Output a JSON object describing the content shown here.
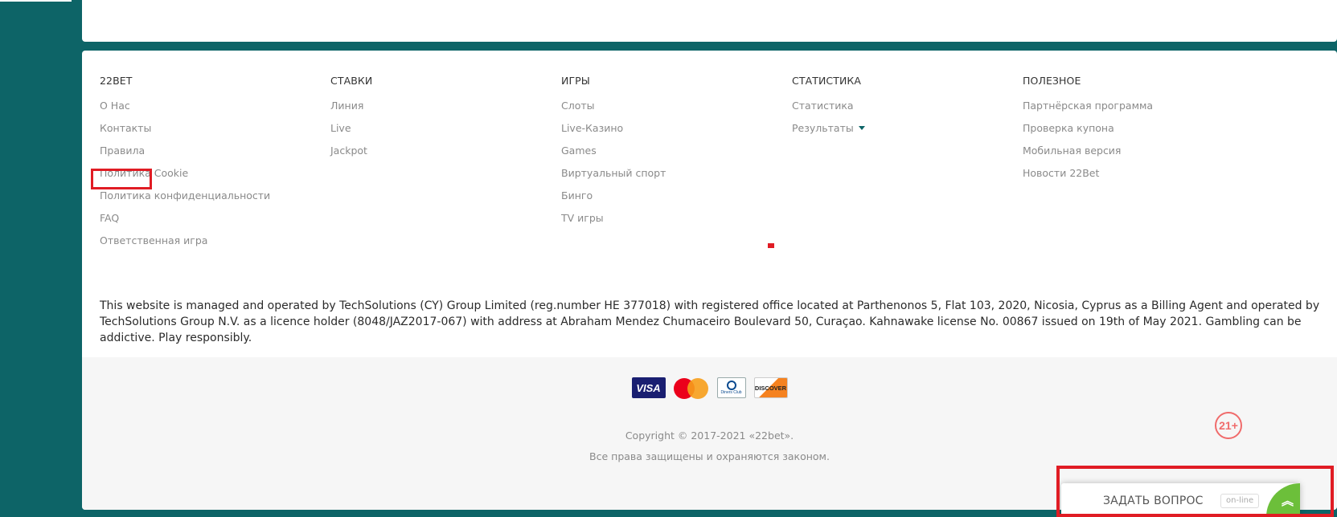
{
  "footer": {
    "columns": [
      {
        "title": "22BET",
        "items": [
          "О Нас",
          "Контакты",
          "Правила",
          "Политика Cookie",
          "Политика конфиденциальности",
          "FAQ",
          "Ответственная игра"
        ]
      },
      {
        "title": "СТАВКИ",
        "items": [
          "Линия",
          "Live",
          "Jackpot"
        ]
      },
      {
        "title": "ИГРЫ",
        "items": [
          "Слоты",
          "Live-Казино",
          "Games",
          "Виртуальный спорт",
          "Бинго",
          "TV игры"
        ]
      },
      {
        "title": "СТАТИСТИКА",
        "items": [
          "Статистика",
          "Результаты"
        ]
      },
      {
        "title": "ПОЛЕЗНОЕ",
        "items": [
          "Партнёрская программа",
          "Проверка купона",
          "Мобильная версия",
          "Новости 22Bet"
        ]
      }
    ],
    "legal_text": "This website is managed and operated by TechSolutions (CY) Group Limited (reg.number HE 377018) with registered office located at Parthenonos 5, Flat 103, 2020, Nicosia, Cyprus as a Billing Agent and operated by TechSolutions Group N.V. as a licence holder (8048/JAZ2017-067) with address at Abraham Mendez Chumaceiro Boulevard 50, Curaçao. Kahnawake license No. 00867 issued on 19th of May 2021. Gambling can be addictive. Play responsibly.",
    "payments": {
      "visa": "VISA",
      "mastercard": "mastercard-logo",
      "diners": "Diners Club",
      "discover": "DISCOVER"
    },
    "copyright": "Copyright © 2017-2021 «22bet».",
    "rights": "Все права защищены и охраняются законом.",
    "age_badge": "21+"
  },
  "chat": {
    "label": "ЗАДАТЬ ВОПРОС",
    "status": "on-line",
    "chevron_icon": "double-chevron-up-icon"
  },
  "colors": {
    "background": "#0d6467",
    "highlight": "#e01c24",
    "chat_accent": "#6cbf3a"
  }
}
